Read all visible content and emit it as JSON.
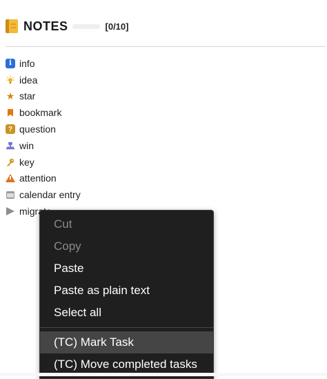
{
  "header": {
    "title": "NOTES",
    "count": "[0/10]",
    "progress": 0
  },
  "items": [
    {
      "label": "info",
      "icon": "info-icon"
    },
    {
      "label": "idea",
      "icon": "lightbulb-icon"
    },
    {
      "label": "star",
      "icon": "star-icon"
    },
    {
      "label": "bookmark",
      "icon": "bookmark-icon"
    },
    {
      "label": "question",
      "icon": "question-icon"
    },
    {
      "label": "win",
      "icon": "trophy-icon"
    },
    {
      "label": "key",
      "icon": "key-icon"
    },
    {
      "label": "attention",
      "icon": "warning-icon"
    },
    {
      "label": "calendar entry",
      "icon": "calendar-icon"
    },
    {
      "label": "migrate",
      "icon": "arrow-right-icon"
    }
  ],
  "context_menu": {
    "items": [
      {
        "label": "Cut",
        "enabled": false
      },
      {
        "label": "Copy",
        "enabled": false
      },
      {
        "label": "Paste",
        "enabled": true
      },
      {
        "label": "Paste as plain text",
        "enabled": true
      },
      {
        "label": "Select all",
        "enabled": true
      }
    ],
    "plugin_items": [
      {
        "label": "(TC) Mark Task",
        "highlighted": true
      },
      {
        "label": "(TC) Move completed tasks",
        "highlighted": false
      }
    ]
  },
  "colors": {
    "accent_info": "#2a6fd6",
    "notebook": "#f5b93a",
    "menu_background": "#1f1f1f",
    "menu_highlight": "#454545"
  }
}
